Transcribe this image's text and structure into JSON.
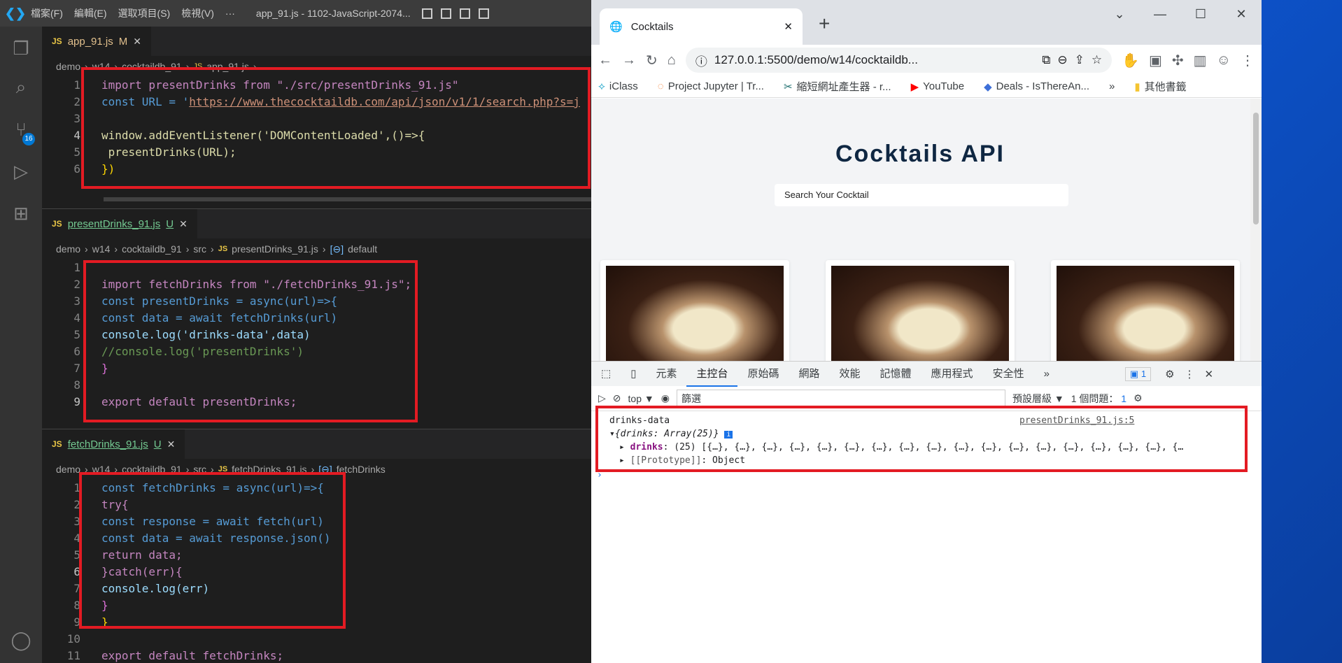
{
  "vscode": {
    "menus": [
      "檔案(F)",
      "編輯(E)",
      "選取項目(S)",
      "檢視(V)",
      "···"
    ],
    "title": "app_91.js - 1102-JavaScript-2074...",
    "scm_badge": "16",
    "panes": [
      {
        "tab_name": "app_91.js",
        "tab_status": "M",
        "breadcrumb": [
          "demo",
          "w14",
          "cocktaildb_91",
          "app_91.js",
          "..."
        ],
        "line_numbers": [
          "1",
          "2",
          "3",
          "4",
          "5",
          "6"
        ],
        "current_line": "4"
      },
      {
        "tab_name": "presentDrinks_91.js",
        "tab_status": "U",
        "breadcrumb": [
          "demo",
          "w14",
          "cocktaildb_91",
          "src",
          "presentDrinks_91.js",
          "default"
        ],
        "line_numbers": [
          "1",
          "2",
          "3",
          "4",
          "5",
          "6",
          "7",
          "8",
          "9"
        ],
        "current_line": "9"
      },
      {
        "tab_name": "fetchDrinks_91.js",
        "tab_status": "U",
        "breadcrumb": [
          "demo",
          "w14",
          "cocktaildb_91",
          "src",
          "fetchDrinks_91.js",
          "fetchDrinks"
        ],
        "line_numbers": [
          "1",
          "2",
          "3",
          "4",
          "5",
          "6",
          "7",
          "8",
          "9",
          "10",
          "11"
        ],
        "current_line": "6"
      }
    ],
    "code": {
      "p1_l1": "import presentDrinks from \"./src/presentDrinks_91.js\"",
      "p1_l2_kw": "const URL = '",
      "p1_l2_url": "https://www.thecocktaildb.com/api/json/v1/1/search.php?s=j",
      "p1_l4": "window.addEventListener('DOMContentLoaded',()=>{",
      "p1_l5": " presentDrinks(URL);",
      "p1_l6": "})",
      "p2_l2": "import fetchDrinks from \"./fetchDrinks_91.js\";",
      "p2_l3": "const presentDrinks = async(url)=>{",
      "p2_l4": "const data = await fetchDrinks(url)",
      "p2_l5": "console.log('drinks-data',data)",
      "p2_l6": "//console.log('presentDrinks')",
      "p2_l7": "}",
      "p2_l9": "export default presentDrinks;",
      "p3_l1": "const fetchDrinks = async(url)=>{",
      "p3_l2": "try{",
      "p3_l3": "const response = await fetch(url)",
      "p3_l4": "const data = await response.json()",
      "p3_l5": "return data;",
      "p3_l6": "}catch(err){",
      "p3_l7": "console.log(err)",
      "p3_l8": "}",
      "p3_l9": "}",
      "p3_l11": "export default fetchDrinks;"
    }
  },
  "browser": {
    "tab_title": "Cocktails",
    "url": "127.0.0.1:5500/demo/w14/cocktaildb...",
    "bookmarks": [
      "iClass",
      "Project Jupyter | Tr...",
      "縮短網址產生器 - r...",
      "YouTube",
      "Deals - IsThereAn...",
      "»",
      "其他書籤"
    ],
    "page_heading": "Cocktails API",
    "search_placeholder": "Search Your Cocktail",
    "devtools_tabs": [
      "元素",
      "主控台",
      "原始碼",
      "網路",
      "效能",
      "記憶體",
      "應用程式",
      "安全性",
      "»"
    ],
    "issues_count": "1",
    "context": "top",
    "filter_placeholder": "篩選",
    "levels": "預設層級 ▼",
    "issues_text": "1 個問題：",
    "issues_badge": "1",
    "console": {
      "label": "drinks-data",
      "source": "presentDrinks_91.js:5",
      "object": "{drinks: Array(25)}",
      "drinks_key": "drinks",
      "drinks_value": ": (25) [{…}, {…}, {…}, {…}, {…}, {…}, {…}, {…}, {…}, {…}, {…}, {…}, {…}, {…}, {…}, {…}, {…}, {…",
      "proto_key": "[[Prototype]]",
      "proto_value": ": Object"
    }
  },
  "colors": {
    "highlight_box": "#e31b23",
    "vscode_bg": "#1e1e1e",
    "accent": "#1a73e8"
  }
}
